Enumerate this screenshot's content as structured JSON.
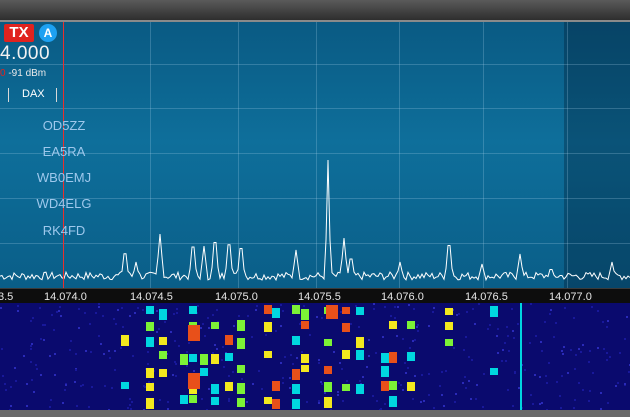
{
  "panadapter": {
    "tx_badge": "TX",
    "slice_letter": "A",
    "frequency_text": "4.000",
    "signal_level": "-91 dBm",
    "signal_prefix": "0",
    "dax_label": "DAX",
    "callsigns": [
      "OD5ZZ",
      "EA5RA",
      "WB0EMJ",
      "WD4ELG",
      "RK4FD"
    ],
    "colors": {
      "background": "#0e6f9b",
      "spectrum_trace": "#ffffff",
      "tx_marker": "#e8302e",
      "callsign_text": "#9ec8ec"
    }
  },
  "frequency_scale": {
    "labels": [
      "3.5",
      "14.074.0",
      "14.074.5",
      "14.075.0",
      "14.075.5",
      "14.076.0",
      "14.076.5",
      "14.077.0"
    ]
  },
  "waterfall": {
    "colors": {
      "background": "#0a0a6e",
      "weak": "#00d6e0",
      "medium": "#7cf236",
      "strong": "#f3e81e",
      "peak": "#e8501a"
    }
  }
}
